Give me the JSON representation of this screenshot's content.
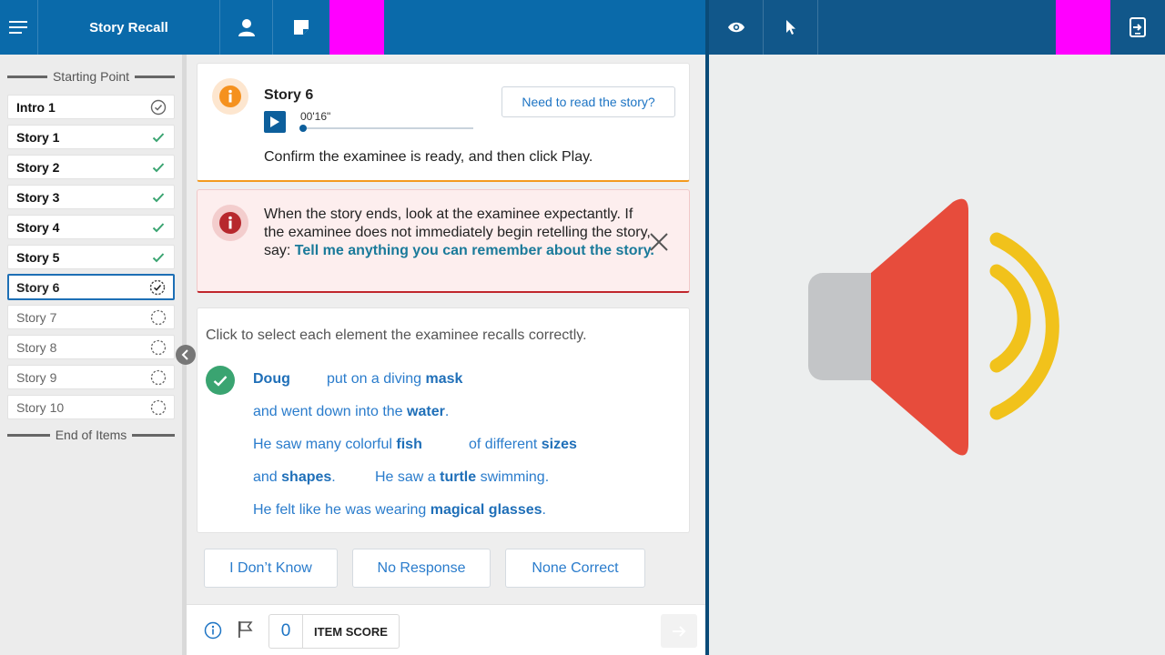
{
  "app": {
    "title": "Story Recall"
  },
  "colors": {
    "topbar": "#0a6aaa",
    "topbar_right": "#11578a",
    "accent": "#1d74c4",
    "success": "#3aa471",
    "warning": "#f39a1e",
    "danger": "#c0262c",
    "placeholder": "#ff00ff"
  },
  "toolbar_left": {
    "icons": [
      "menu-icon",
      "person-icon",
      "note-icon"
    ]
  },
  "toolbar_right": {
    "icons": [
      "eye-icon",
      "cursor-icon",
      "switch-device-icon"
    ]
  },
  "sidebar": {
    "start_label": "Starting Point",
    "end_label": "End of Items",
    "items": [
      {
        "label": "Intro 1",
        "status": "reviewed"
      },
      {
        "label": "Story 1",
        "status": "complete"
      },
      {
        "label": "Story 2",
        "status": "complete"
      },
      {
        "label": "Story 3",
        "status": "complete"
      },
      {
        "label": "Story 4",
        "status": "complete"
      },
      {
        "label": "Story 5",
        "status": "complete"
      },
      {
        "label": "Story 6",
        "status": "in-progress"
      },
      {
        "label": "Story 7",
        "status": "pending"
      },
      {
        "label": "Story 8",
        "status": "pending"
      },
      {
        "label": "Story 9",
        "status": "pending"
      },
      {
        "label": "Story 10",
        "status": "pending"
      }
    ]
  },
  "story_card": {
    "title": "Story 6",
    "need_button": "Need to read the story?",
    "time": "00'16\"",
    "progress": 0.02,
    "instruction": "Confirm the examinee is ready, and then click Play."
  },
  "alert": {
    "text": "When the story ends, look at the examinee expectantly. If the examinee does not immediately begin retelling the story, say: ",
    "prompt": "Tell me anything you can remember about the story."
  },
  "recall": {
    "instruction": "Click to select each element the examinee recalls correctly.",
    "phrases": [
      {
        "pre": "",
        "key": "Doug",
        "post": ""
      },
      {
        "pre": "put on a diving ",
        "key": "mask",
        "post": ""
      },
      {
        "pre": "and went down into the ",
        "key": "water",
        "post": "."
      },
      {
        "pre": "He saw many colorful ",
        "key": "fish",
        "post": ""
      },
      {
        "pre": "of different ",
        "key": "sizes",
        "post": ""
      },
      {
        "pre": "and ",
        "key": "shapes",
        "post": "."
      },
      {
        "pre": "He saw a ",
        "key": "turtle",
        "post": " swimming."
      },
      {
        "pre": "He felt like he was wearing ",
        "key": "magical glasses",
        "post": "."
      }
    ]
  },
  "responses": {
    "dont_know": "I Don’t Know",
    "no_response": "No Response",
    "none_correct": "None Correct"
  },
  "footer": {
    "score_value": "0",
    "score_label": "ITEM SCORE"
  },
  "right_pane": {
    "illustration": "speaker-volume-icon"
  }
}
